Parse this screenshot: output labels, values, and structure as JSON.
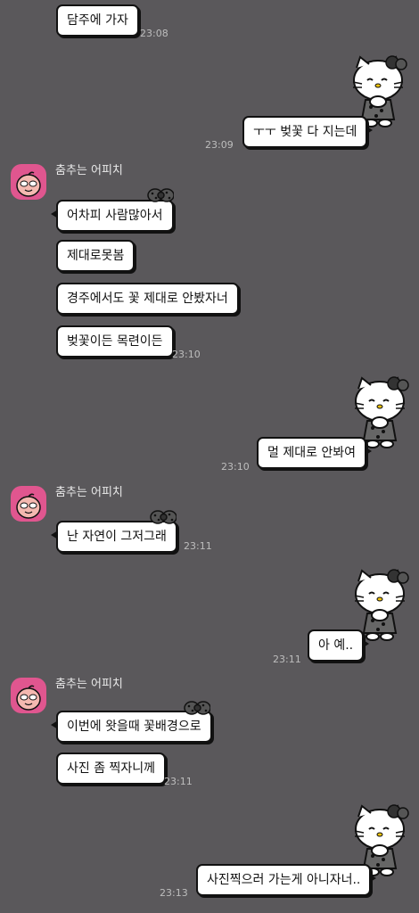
{
  "chat": {
    "sender_name": "춤추는 어피치",
    "messages": [
      {
        "text": "담주에 가자",
        "time": "23:08"
      },
      {
        "text": "ㅜㅜ 벚꽃 다 지는데",
        "time": "23:09"
      },
      {
        "text": "어차피 사람많아서"
      },
      {
        "text": "제대로못봄"
      },
      {
        "text": "경주에서도 꽃 제대로 안봤자너"
      },
      {
        "text": "벚꽃이든 목련이든",
        "time": "23:10"
      },
      {
        "text": "멀 제대로 안봐여",
        "time": "23:10"
      },
      {
        "text": "난 자연이 그저그래",
        "time": "23:11"
      },
      {
        "text": "아 예..",
        "time": "23:11"
      },
      {
        "text": "이번에 왓을때 꽃배경으로"
      },
      {
        "text": "사진 좀 찍자니께",
        "time": "23:11"
      },
      {
        "text": "사진찍으러 가는게 아니자너..",
        "time": "23:13"
      }
    ]
  },
  "icons": {
    "avatar": "apeach-avatar-icon",
    "bubble_decoration": "leopard-bow-icon",
    "sticker": "hello-kitty-sticker-icon"
  },
  "colors": {
    "background": "#5a585b",
    "bubble": "#ffffff",
    "avatar": "#e0568f"
  }
}
